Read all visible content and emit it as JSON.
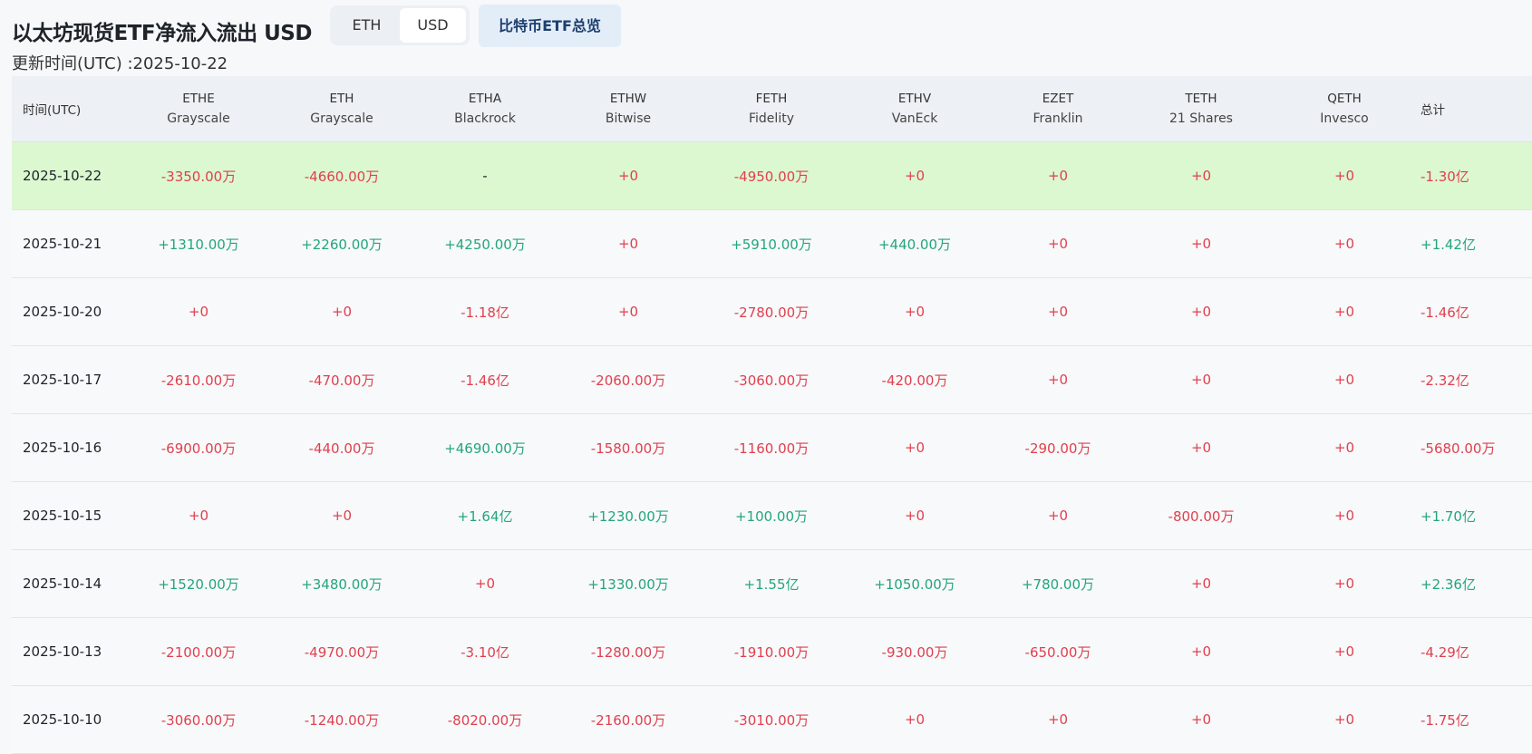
{
  "header": {
    "title": "以太坊现货ETF净流入流出 USD",
    "unit_toggle": [
      "ETH",
      "USD"
    ],
    "unit_selected": "USD",
    "btc_button": "比特币ETF总览",
    "updated": "更新时间(UTC) :2025-10-22"
  },
  "colors": {
    "positive": "#24a57c",
    "negative": "#e0404f",
    "neutral": "#1e2329",
    "highlight_row": "#dcf8d0"
  },
  "table": {
    "date_header": "时间(UTC)",
    "total_header": "总计",
    "columns": [
      {
        "ticker": "ETHE",
        "issuer": "Grayscale"
      },
      {
        "ticker": "ETH",
        "issuer": "Grayscale"
      },
      {
        "ticker": "ETHA",
        "issuer": "Blackrock"
      },
      {
        "ticker": "ETHW",
        "issuer": "Bitwise"
      },
      {
        "ticker": "FETH",
        "issuer": "Fidelity"
      },
      {
        "ticker": "ETHV",
        "issuer": "VanEck"
      },
      {
        "ticker": "EZET",
        "issuer": "Franklin"
      },
      {
        "ticker": "TETH",
        "issuer": "21 Shares"
      },
      {
        "ticker": "QETH",
        "issuer": "Invesco"
      }
    ],
    "rows": [
      {
        "date": "2025-10-22",
        "highlighted": true,
        "values": [
          "-3350.00万",
          "-4660.00万",
          "-",
          "+0",
          "-4950.00万",
          "+0",
          "+0",
          "+0",
          "+0"
        ],
        "total": "-1.30亿"
      },
      {
        "date": "2025-10-21",
        "values": [
          "+1310.00万",
          "+2260.00万",
          "+4250.00万",
          "+0",
          "+5910.00万",
          "+440.00万",
          "+0",
          "+0",
          "+0"
        ],
        "total": "+1.42亿"
      },
      {
        "date": "2025-10-20",
        "values": [
          "+0",
          "+0",
          "-1.18亿",
          "+0",
          "-2780.00万",
          "+0",
          "+0",
          "+0",
          "+0"
        ],
        "total": "-1.46亿"
      },
      {
        "date": "2025-10-17",
        "values": [
          "-2610.00万",
          "-470.00万",
          "-1.46亿",
          "-2060.00万",
          "-3060.00万",
          "-420.00万",
          "+0",
          "+0",
          "+0"
        ],
        "total": "-2.32亿"
      },
      {
        "date": "2025-10-16",
        "values": [
          "-6900.00万",
          "-440.00万",
          "+4690.00万",
          "-1580.00万",
          "-1160.00万",
          "+0",
          "-290.00万",
          "+0",
          "+0"
        ],
        "total": "-5680.00万"
      },
      {
        "date": "2025-10-15",
        "values": [
          "+0",
          "+0",
          "+1.64亿",
          "+1230.00万",
          "+100.00万",
          "+0",
          "+0",
          "-800.00万",
          "+0"
        ],
        "total": "+1.70亿"
      },
      {
        "date": "2025-10-14",
        "values": [
          "+1520.00万",
          "+3480.00万",
          "+0",
          "+1330.00万",
          "+1.55亿",
          "+1050.00万",
          "+780.00万",
          "+0",
          "+0"
        ],
        "total": "+2.36亿"
      },
      {
        "date": "2025-10-13",
        "values": [
          "-2100.00万",
          "-4970.00万",
          "-3.10亿",
          "-1280.00万",
          "-1910.00万",
          "-930.00万",
          "-650.00万",
          "+0",
          "+0"
        ],
        "total": "-4.29亿"
      },
      {
        "date": "2025-10-10",
        "values": [
          "-3060.00万",
          "-1240.00万",
          "-8020.00万",
          "-2160.00万",
          "-3010.00万",
          "+0",
          "+0",
          "+0",
          "+0"
        ],
        "total": "-1.75亿"
      }
    ]
  }
}
